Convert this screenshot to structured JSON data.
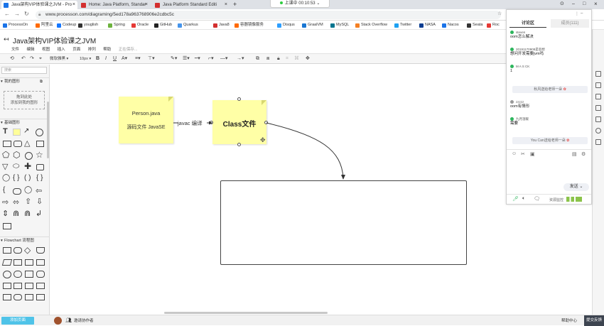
{
  "browser": {
    "tabs": [
      {
        "title": "Java架构VIP体验课之JVM - Pro",
        "active": true,
        "color": "#1a73e8"
      },
      {
        "title": "Home: Java Platform, Standar",
        "active": false,
        "color": "#d32f2f"
      },
      {
        "title": "Java Platform Standard Editi",
        "active": false,
        "color": "#d32f2f"
      }
    ],
    "new_tab": "+",
    "timer": "上课中 00:10:53",
    "url": "www.processon.com/diagraming/5ed178a963768906e2cdbc5c",
    "bookmarks": [
      {
        "label": "ProcessOn",
        "color": "#1a73e8"
      },
      {
        "label": "阿里云",
        "color": "#ff6a00"
      },
      {
        "label": "Codeup",
        "color": "#1677ff"
      },
      {
        "label": "youglish",
        "color": "#333333"
      },
      {
        "label": "Spring",
        "color": "#6db33f"
      },
      {
        "label": "Oracle",
        "color": "#e53935"
      },
      {
        "label": "GitHub",
        "color": "#222222"
      },
      {
        "label": "Quarkus",
        "color": "#4695eb"
      },
      {
        "label": "Java8",
        "color": "#d32f2f"
      },
      {
        "label": "容器镜像服务",
        "color": "#ff6a00"
      },
      {
        "label": "Disqus",
        "color": "#2e9fff"
      },
      {
        "label": "GraalVM",
        "color": "#1976d2"
      },
      {
        "label": "MySQL",
        "color": "#00758f"
      },
      {
        "label": "Stack Overflow",
        "color": "#f48024"
      },
      {
        "label": "Twitter",
        "color": "#1da1f2"
      },
      {
        "label": "NASA",
        "color": "#0b3d91"
      },
      {
        "label": "Nacos",
        "color": "#1a73e8"
      },
      {
        "label": "Seata",
        "color": "#333333"
      },
      {
        "label": "Roc",
        "color": "#e53935"
      }
    ]
  },
  "app": {
    "title": "Java架构VIP体验课之JVM",
    "menu": [
      "文件",
      "编辑",
      "视图",
      "插入",
      "页面",
      "排列",
      "帮助"
    ],
    "save_status": "正在保存...",
    "toolbar": {
      "font": "微软雅黑",
      "size": "10px",
      "bold": "B",
      "italic": "I",
      "underline": "U",
      "font_color": "A"
    }
  },
  "left_panel": {
    "search_placeholder": "搜索",
    "my_shapes": "我的图形",
    "drop_hint_1": "拖到此处",
    "drop_hint_2": "添加到我的图形",
    "basic_shapes": "基础图形",
    "text_tool": "T",
    "flowchart": "Flowchart 流程图"
  },
  "canvas": {
    "note1_line1": "Person.java",
    "note1_line2": "源码文件  JavaSE",
    "edge_label": "javac 编译",
    "note2": "Class文件"
  },
  "chat": {
    "tab_discuss": "讨论区",
    "tab_members": "成员(111)",
    "messages": [
      {
        "name": "steven",
        "text": "oom怎么解决"
      },
      {
        "name": "20191170908是思想",
        "text": "想问开发需要jvm吗"
      },
      {
        "name": "M A S CK",
        "text": "1"
      },
      {
        "name": "zzzzz",
        "text": "oom有情形"
      },
      {
        "name": "九月温暖",
        "text": "需要"
      }
    ],
    "notice1": "秋风送给老师一朵",
    "notice2": "You Can送给老师一朵",
    "send": "发送",
    "resource": "资源监控"
  },
  "bottom": {
    "left_btn": "添加页面",
    "invite": "邀请协作者",
    "help": "帮助中心",
    "feedback": "提交反馈"
  },
  "colors": {
    "accent": "#1a73e8",
    "sticky": "#ffffa6",
    "chat_green": "#2db55d"
  }
}
